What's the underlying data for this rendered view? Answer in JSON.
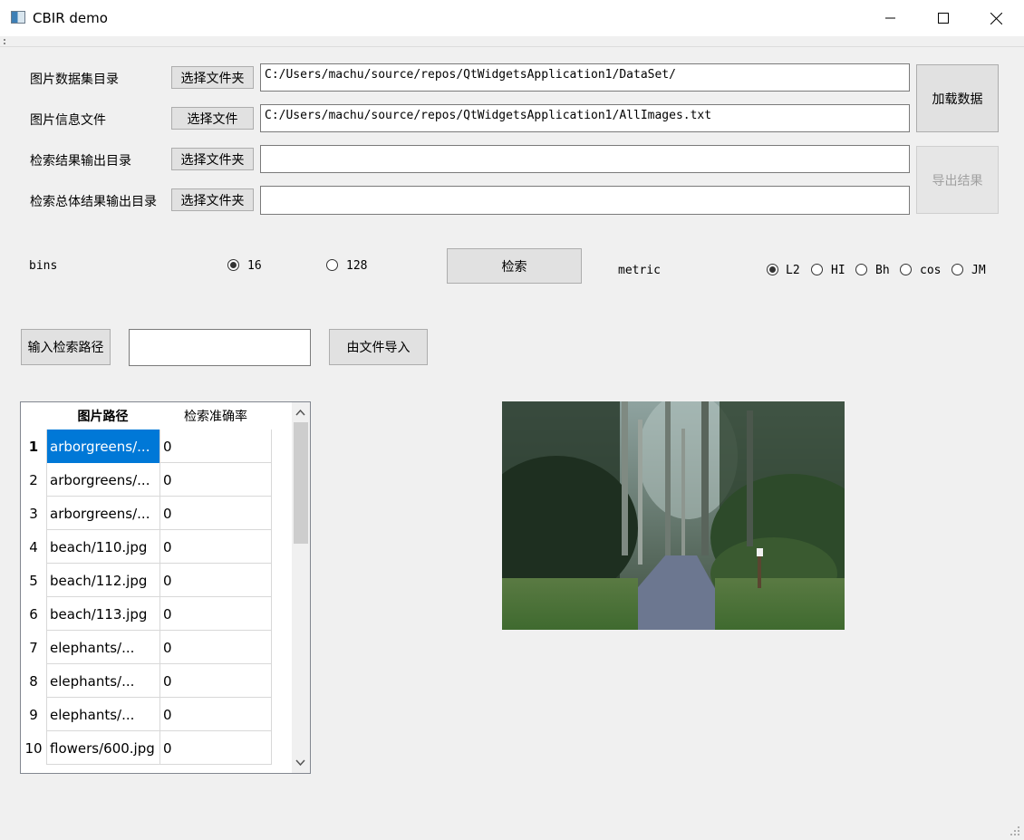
{
  "window": {
    "title": "CBIR demo",
    "min": "—",
    "max": "☐",
    "close": "✕"
  },
  "form": {
    "rows": [
      {
        "label": "图片数据集目录",
        "button": "选择文件夹",
        "value": "C:/Users/machu/source/repos/QtWidgetsApplication1/DataSet/"
      },
      {
        "label": "图片信息文件",
        "button": "选择文件",
        "value": "C:/Users/machu/source/repos/QtWidgetsApplication1/AllImages.txt"
      },
      {
        "label": "检索结果输出目录",
        "button": "选择文件夹",
        "value": ""
      },
      {
        "label": "检索总体结果输出目录",
        "button": "选择文件夹",
        "value": ""
      }
    ],
    "load_button": "加载数据",
    "export_button": "导出结果"
  },
  "bins": {
    "label": "bins",
    "options": [
      "16",
      "128"
    ],
    "selected": "16"
  },
  "search_button": "检索",
  "metric": {
    "label": "metric",
    "options": [
      "L2",
      "HI",
      "Bh",
      "cos",
      "JM"
    ],
    "selected": "L2"
  },
  "query": {
    "path_button": "输入检索路径",
    "path_value": "",
    "import_button": "由文件导入"
  },
  "table": {
    "headers": [
      "图片路径",
      "检索准确率"
    ],
    "rows": [
      {
        "num": "1",
        "path": "arborgreens/...",
        "acc": "0"
      },
      {
        "num": "2",
        "path": "arborgreens/...",
        "acc": "0"
      },
      {
        "num": "3",
        "path": "arborgreens/...",
        "acc": "0"
      },
      {
        "num": "4",
        "path": "beach/110.jpg",
        "acc": "0"
      },
      {
        "num": "5",
        "path": "beach/112.jpg",
        "acc": "0"
      },
      {
        "num": "6",
        "path": "beach/113.jpg",
        "acc": "0"
      },
      {
        "num": "7",
        "path": "elephants/...",
        "acc": "0"
      },
      {
        "num": "8",
        "path": "elephants/...",
        "acc": "0"
      },
      {
        "num": "9",
        "path": "elephants/...",
        "acc": "0"
      },
      {
        "num": "10",
        "path": "flowers/600.jpg",
        "acc": "0"
      }
    ],
    "selected_row": 0
  },
  "colors": {
    "selection": "#0078d7",
    "background": "#f0f0f0"
  }
}
